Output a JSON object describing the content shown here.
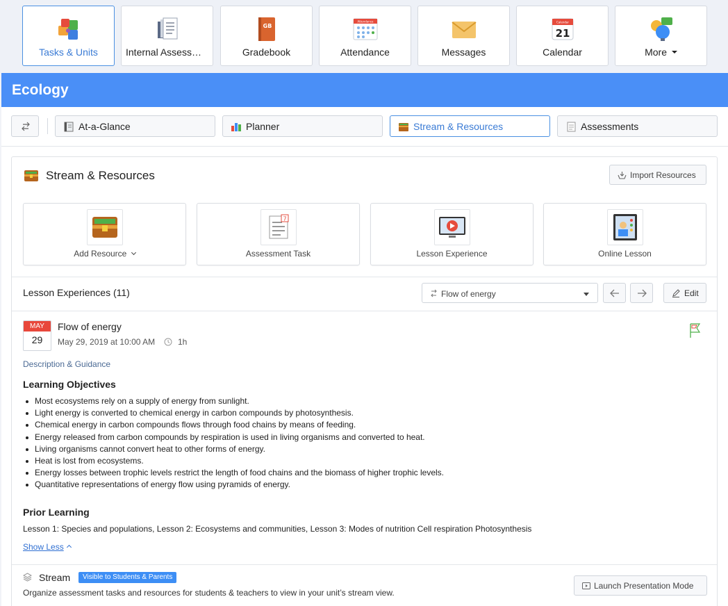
{
  "app_tiles": [
    {
      "label": "Tasks & Units",
      "icon": "puzzle-icon"
    },
    {
      "label": "Internal Assessments",
      "icon": "document-stack-icon"
    },
    {
      "label": "Gradebook",
      "icon": "gradebook-icon"
    },
    {
      "label": "Attendance",
      "icon": "attendance-icon"
    },
    {
      "label": "Messages",
      "icon": "envelope-icon"
    },
    {
      "label": "Calendar",
      "icon": "calendar-icon"
    },
    {
      "label": "More",
      "icon": "lightbulb-chat-icon"
    }
  ],
  "gradebook_icon_text": "GB",
  "attendance_icon_text": "Attendance",
  "calendar_icon": {
    "month": "Calendar",
    "day": "21"
  },
  "course": {
    "title": "Ecology"
  },
  "subnav": [
    {
      "label": "At-a-Glance",
      "icon": "notebook-icon"
    },
    {
      "label": "Planner",
      "icon": "bar-chart-icon"
    },
    {
      "label": "Stream & Resources",
      "icon": "treasure-chest-icon"
    },
    {
      "label": "Assessments",
      "icon": "notepad-icon"
    }
  ],
  "stream_resources": {
    "title": "Stream & Resources",
    "import_button": "Import Resources",
    "tiles": [
      {
        "label": "Add Resource",
        "icon": "treasure-chest-icon"
      },
      {
        "label": "Assessment Task",
        "icon": "assessment-task-icon"
      },
      {
        "label": "Lesson Experience",
        "icon": "video-play-icon"
      },
      {
        "label": "Online Lesson",
        "icon": "online-lesson-icon"
      }
    ],
    "assessment_icon_number": "7"
  },
  "lesson_experiences": {
    "title": "Lesson Experiences (11)",
    "selected": "Flow of energy",
    "edit_label": "Edit"
  },
  "lesson": {
    "month": "MAY",
    "day": "29",
    "title": "Flow of energy",
    "datetime": "May 29, 2019 at 10:00 AM",
    "duration": "1h",
    "description_label": "Description & Guidance",
    "objectives_heading": "Learning Objectives",
    "objectives": [
      "Most ecosystems rely on a supply of energy from sunlight.",
      "Light energy is converted to chemical energy in carbon compounds by photosynthesis.",
      "Chemical energy in carbon compounds flows through food chains by means of feeding.",
      "Energy released from carbon compounds by respiration is used in living organisms and converted to heat.",
      "Living organisms cannot convert heat to other forms of energy.",
      "Heat is lost from ecosystems.",
      "Energy losses between trophic levels restrict the length of food chains and the biomass of higher trophic levels.",
      "Quantitative representations of energy flow using pyramids of energy."
    ],
    "prior_heading": "Prior Learning",
    "prior_text": "Lesson 1: Species and populations, Lesson 2: Ecosystems and communities, Lesson 3: Modes of nutrition Cell respiration Photosynthesis",
    "show_less": "Show Less"
  },
  "stream": {
    "title": "Stream",
    "badge": "Visible to Students & Parents",
    "description": "Organize assessment tasks and resources for students & teachers to view in your unit’s stream view.",
    "launch_button": "Launch Presentation Mode"
  },
  "colors": {
    "header_blue": "#4a8ff7",
    "active_blue": "#3a7bd5",
    "badge_blue": "#3d8ef5",
    "date_red": "#e8473b",
    "link_blue": "#2f6fd2"
  }
}
